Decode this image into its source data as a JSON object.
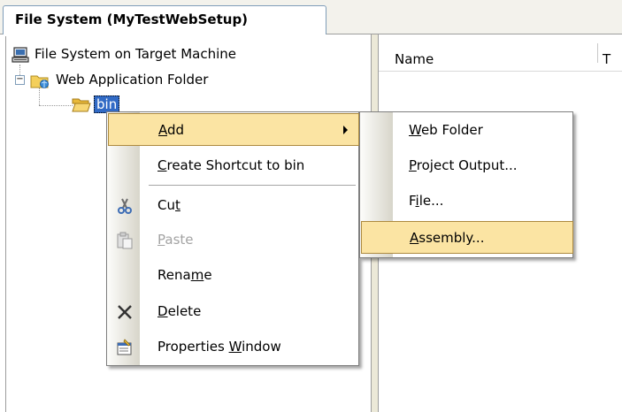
{
  "tab": {
    "title": "File System (MyTestWebSetup)"
  },
  "tree": {
    "root_label": "File System on Target Machine",
    "web_folder_label": "Web Application Folder",
    "expander_symbol": "−",
    "bin_label": "bin"
  },
  "list": {
    "col_name": "Name",
    "col_second": "T"
  },
  "context_menu": {
    "items": [
      {
        "label": "Add",
        "icon": "",
        "highlighted": true,
        "has_submenu": true,
        "enabled": true
      },
      {
        "label": "Create Shortcut to bin",
        "icon": "",
        "enabled": true
      },
      {
        "label": "Cut",
        "icon": "scissors-icon",
        "enabled": true
      },
      {
        "label": "Paste",
        "icon": "paste-icon",
        "enabled": false
      },
      {
        "label": "Rename",
        "icon": "",
        "enabled": true
      },
      {
        "label": "Delete",
        "icon": "delete-x-icon",
        "enabled": true
      },
      {
        "label": "Properties Window",
        "icon": "properties-icon",
        "enabled": true
      }
    ]
  },
  "submenu": {
    "items": [
      {
        "label": "Web Folder",
        "enabled": true
      },
      {
        "label": "Project Output...",
        "enabled": true
      },
      {
        "label": "File...",
        "enabled": true
      },
      {
        "label": "Assembly...",
        "highlighted": true,
        "enabled": true
      }
    ]
  },
  "colors": {
    "menu_highlight": "#fbe4a3",
    "menu_highlight_border": "#ad8a3f",
    "selection": "#316ac5",
    "disabled_text": "#a3a3a3"
  }
}
